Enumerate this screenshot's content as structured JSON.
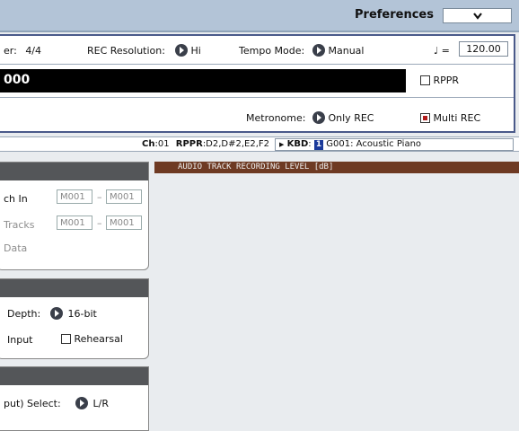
{
  "header": {
    "page_title": "Preferences",
    "menu_icon": "chevron-down-icon"
  },
  "top": {
    "meter_label": "er:",
    "meter_value": "4/4",
    "rec_resolution_label": "REC Resolution:",
    "rec_resolution_value": "Hi",
    "tempo_mode_label": "Tempo Mode:",
    "tempo_mode_value": "Manual",
    "tempo_symbol": "♩ =",
    "tempo_value": "120.00",
    "song_name": "000",
    "rppr_label": "RPPR",
    "rppr_checked": false,
    "metronome_label": "Metronome:",
    "metronome_value": "Only REC",
    "multi_rec_label": "Multi REC",
    "multi_rec_checked": true
  },
  "status": {
    "ch_label": "Ch",
    "ch_value": ":01",
    "rppr_label": "RPPR",
    "rppr_value": ":D2,D#2,E2,F2",
    "kbd_label": "KBD",
    "kbd_sep": ":",
    "bank": "1",
    "program": "G001: Acoustic Piano"
  },
  "panel1": {
    "punch_label": "ch In",
    "punch_from": "M001",
    "punch_dash": "–",
    "punch_to": "M001",
    "tracks_label": "Tracks",
    "tracks_from": "M001",
    "tracks_dash": "–",
    "tracks_to": "M001",
    "data_label": "Data"
  },
  "panel2": {
    "depth_label": "Depth:",
    "depth_value": "16-bit",
    "input_label": "Input",
    "rehearsal_label": "Rehearsal",
    "rehearsal_checked": false
  },
  "panel3": {
    "select_label": "put) Select:",
    "select_value": "L/R"
  },
  "audio": {
    "level_title": "AUDIO TRACK RECORDING LEVEL [dB]"
  }
}
